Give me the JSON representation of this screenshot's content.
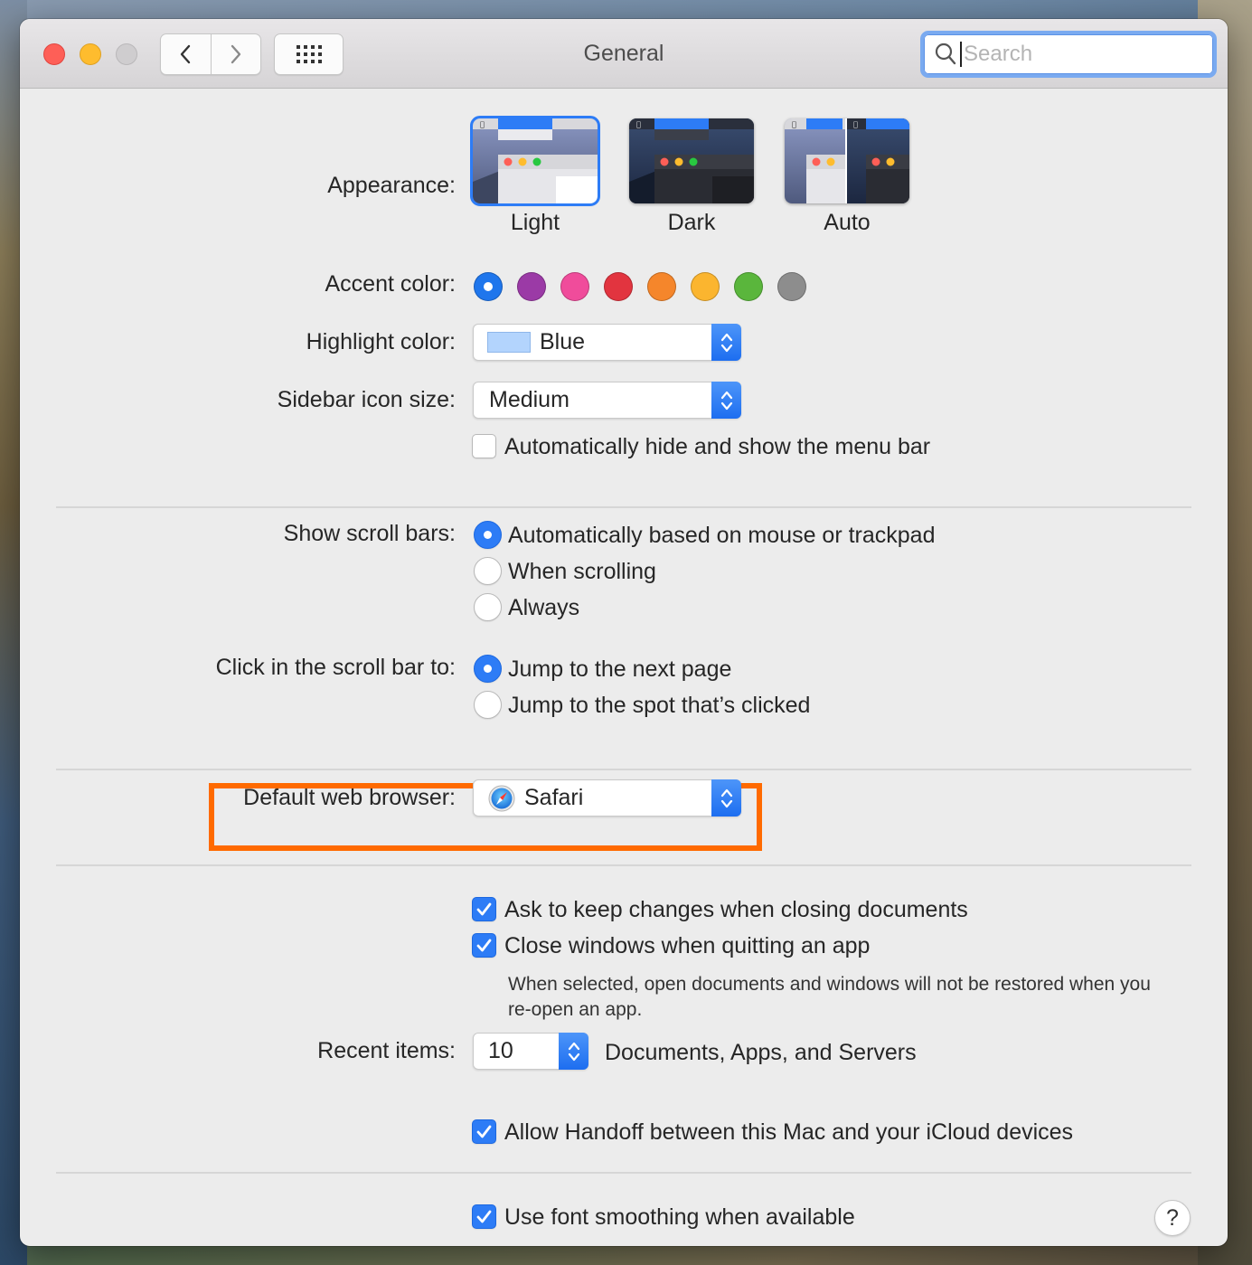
{
  "window": {
    "title": "General",
    "search_placeholder": "Search"
  },
  "appearance": {
    "label": "Appearance:",
    "options": [
      "Light",
      "Dark",
      "Auto"
    ],
    "selected": "Light"
  },
  "accent": {
    "label": "Accent color:",
    "colors": [
      "#1f76ec",
      "#9b3aa6",
      "#f04c9b",
      "#e2343f",
      "#f5862b",
      "#fbb52f",
      "#5ab63c",
      "#8d8d8d"
    ],
    "selected_index": 0
  },
  "highlight": {
    "label": "Highlight color:",
    "value": "Blue",
    "swatch_color": "#b3d4fd"
  },
  "sidebar_icon": {
    "label": "Sidebar icon size:",
    "value": "Medium"
  },
  "menubar": {
    "label": "Automatically hide and show the menu bar",
    "checked": false
  },
  "scrollbars": {
    "label": "Show scroll bars:",
    "options": [
      "Automatically based on mouse or trackpad",
      "When scrolling",
      "Always"
    ],
    "selected_index": 0
  },
  "scroll_click": {
    "label": "Click in the scroll bar to:",
    "options": [
      "Jump to the next page",
      "Jump to the spot that’s clicked"
    ],
    "selected_index": 0
  },
  "browser": {
    "label": "Default web browser:",
    "value": "Safari",
    "highlight_color": "#ff6a00"
  },
  "documents": {
    "ask_keep": "Ask to keep changes when closing documents",
    "close_windows": "Close windows when quitting an app",
    "note": "When selected, open documents and windows will not be restored when you re-open an app."
  },
  "recent": {
    "label": "Recent items:",
    "value": "10",
    "suffix": "Documents, Apps, and Servers"
  },
  "handoff": {
    "label": "Allow Handoff between this Mac and your iCloud devices",
    "checked": true
  },
  "smoothing": {
    "label": "Use font smoothing when available",
    "checked": true
  },
  "help": {
    "label": "?"
  }
}
